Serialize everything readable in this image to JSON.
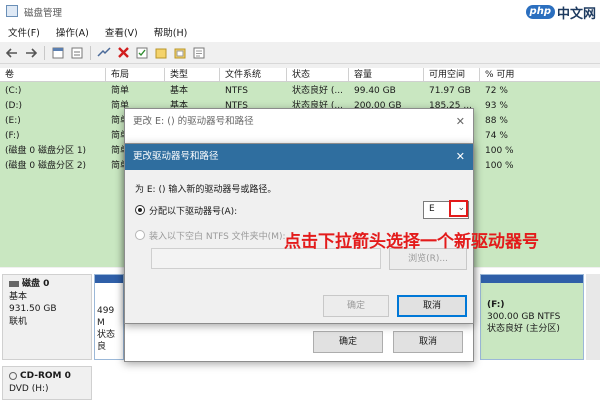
{
  "window": {
    "title": "磁盘管理"
  },
  "brand": {
    "logo": "php",
    "text": "中文网"
  },
  "menu": [
    "文件(F)",
    "操作(A)",
    "查看(V)",
    "帮助(H)"
  ],
  "toolbar_icons": [
    "back-arrow-icon",
    "forward-arrow-icon",
    "sep",
    "properties-icon",
    "help-icon",
    "sep",
    "connect-icon",
    "delete-x-icon",
    "check-icon",
    "new-folder-icon",
    "open-folder-icon",
    "properties-page-icon"
  ],
  "columns": [
    "卷",
    "布局",
    "类型",
    "文件系统",
    "状态",
    "容量",
    "可用空间",
    "% 可用"
  ],
  "volumes": [
    {
      "name": "(C:)",
      "layout": "简单",
      "type": "基本",
      "fs": "NTFS",
      "status": "状态良好 (...",
      "capacity": "99.40 GB",
      "free": "71.97 GB",
      "pct": "72 %"
    },
    {
      "name": "(D:)",
      "layout": "简单",
      "type": "基本",
      "fs": "NTFS",
      "status": "状态良好 (...",
      "capacity": "200.00 GB",
      "free": "185.25 ...",
      "pct": "93 %"
    },
    {
      "name": "(E:)",
      "layout": "简单",
      "type": "",
      "fs": "",
      "status": "",
      "capacity": "",
      "free": "",
      "pct": "88 %"
    },
    {
      "name": "(F:)",
      "layout": "简单",
      "type": "",
      "fs": "",
      "status": "",
      "capacity": "",
      "free": "",
      "pct": "74 %"
    },
    {
      "name": "(磁盘 0 磁盘分区 1)",
      "layout": "简单",
      "type": "",
      "fs": "",
      "status": "",
      "capacity": "",
      "free": "",
      "pct": "100 %"
    },
    {
      "name": "(磁盘 0 磁盘分区 2)",
      "layout": "简单",
      "type": "",
      "fs": "",
      "status": "",
      "capacity": "",
      "free": "",
      "pct": "100 %"
    }
  ],
  "disk0": {
    "label": "磁盘 0",
    "type": "基本",
    "size": "931.50 GB",
    "status": "联机",
    "part_left": {
      "line1": "499 M",
      "line2": "状态良"
    },
    "part_f": {
      "line1": "(F:)",
      "line2": "300.00 GB NTFS",
      "line3": "状态良好 (主分区)"
    }
  },
  "cdrom": {
    "label": "CD-ROM 0",
    "line2": "DVD (H:)"
  },
  "dialog_outer": {
    "title": "更改 E: () 的驱动器号和路径",
    "ok": "确定",
    "cancel": "取消"
  },
  "dialog_inner": {
    "title": "更改驱动器号和路径",
    "prompt": "为 E: () 输入新的驱动器号或路径。",
    "option1": "分配以下驱动器号(A):",
    "option2": "装入以下空白 NTFS 文件夹中(M):",
    "drive_value": "E",
    "browse": "浏览(R)...",
    "ok": "确定",
    "cancel": "取消"
  },
  "annotation": "点击下拉箭头选择一个新驱动器号",
  "colors": {
    "annotation": "#e31b1b",
    "inner_title_bar": "#2f6e9f",
    "volume_bg": "#c9e7c1",
    "partition_bar": "#2f5fa8"
  }
}
